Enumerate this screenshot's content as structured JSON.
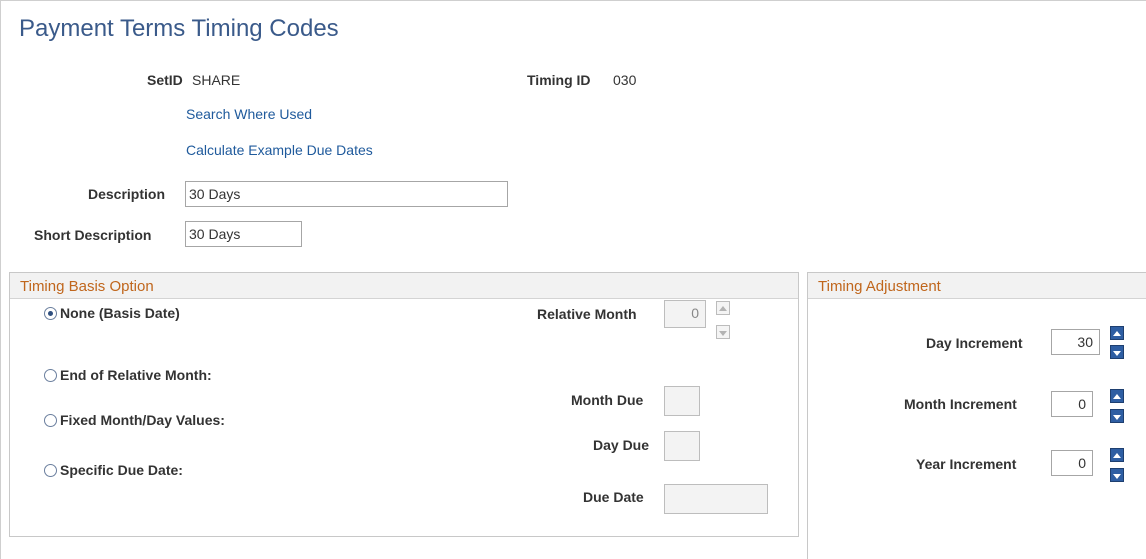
{
  "page": {
    "title": "Payment Terms Timing Codes"
  },
  "header": {
    "setid_label": "SetID",
    "setid_value": "SHARE",
    "timing_id_label": "Timing ID",
    "timing_id_value": "030",
    "search_where_used": "Search Where Used",
    "calculate_example": "Calculate Example Due Dates",
    "description_label": "Description",
    "description_value": "30 Days",
    "short_description_label": "Short Description",
    "short_description_value": "30 Days"
  },
  "timing_basis": {
    "title": "Timing Basis Option",
    "options": [
      {
        "label": "None (Basis Date)",
        "selected": true
      },
      {
        "label": "End of Relative Month:",
        "selected": false
      },
      {
        "label": "Fixed Month/Day Values:",
        "selected": false
      },
      {
        "label": "Specific Due Date:",
        "selected": false
      }
    ],
    "relative_month_label": "Relative Month",
    "relative_month_value": "0",
    "month_due_label": "Month Due",
    "month_due_value": "",
    "day_due_label": "Day Due",
    "day_due_value": "",
    "due_date_label": "Due Date",
    "due_date_value": ""
  },
  "timing_adjustment": {
    "title": "Timing Adjustment",
    "day_increment_label": "Day Increment",
    "day_increment_value": "30",
    "month_increment_label": "Month Increment",
    "month_increment_value": "0",
    "year_increment_label": "Year Increment",
    "year_increment_value": "0"
  },
  "icons": {
    "radio": "radio-button",
    "spin_up": "arrow-up-icon",
    "spin_down": "arrow-down-icon"
  },
  "colors": {
    "title": "#3a5a8a",
    "link": "#1f5a9c",
    "group_title": "#c0661c",
    "spin_active": "#2e5ea3"
  }
}
